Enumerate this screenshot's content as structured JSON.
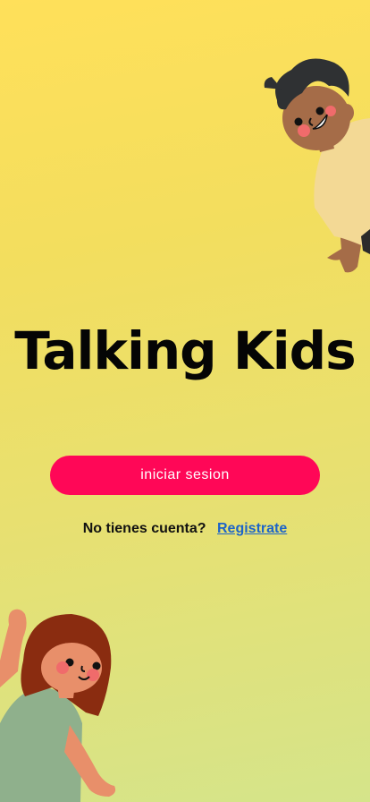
{
  "app": {
    "title": "Talking Kids"
  },
  "actions": {
    "login_label": "iniciar sesion"
  },
  "signup": {
    "prompt": "No tienes cuenta?",
    "link_label": "Registrate"
  },
  "colors": {
    "primary_button": "#ff0757",
    "link": "#1d64c8",
    "background_top": "#ffe05a",
    "background_bottom": "#d5e48a"
  },
  "icons": [
    "boy-illustration",
    "girl-illustration"
  ]
}
